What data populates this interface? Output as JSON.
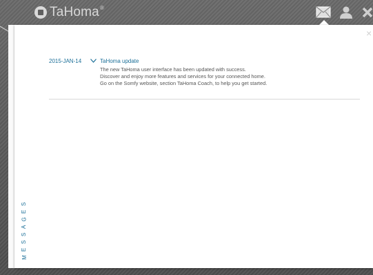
{
  "header": {
    "brand": "TaHoma",
    "brand_mark": "®",
    "icons": [
      "mail-icon",
      "user-icon",
      "close-icon"
    ]
  },
  "panel": {
    "side_label": "MESSAGES",
    "close_glyph": "×"
  },
  "messages": [
    {
      "date": "2015-JAN-14",
      "title": "TaHoma update",
      "lines": [
        "The new TaHoma user interface has been updated with success.",
        "Discover and enjoy more features and services for your connected home.",
        "Go on the Somfy website, section TaHoma Coach, to help you get started."
      ]
    }
  ],
  "colors": {
    "accent": "#1b6f98",
    "text": "#555555",
    "background": "#5f5f5f",
    "panel": "#ffffff"
  }
}
